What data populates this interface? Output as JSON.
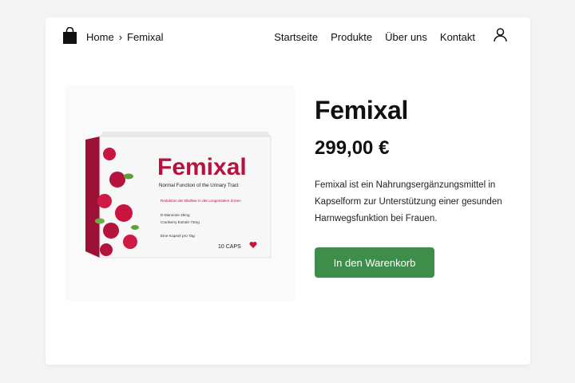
{
  "breadcrumb": {
    "home": "Home",
    "separator": "›",
    "current": "Femixal"
  },
  "nav": {
    "items": [
      "Startseite",
      "Produkte",
      "Über uns",
      "Kontakt"
    ]
  },
  "product": {
    "title": "Femixal",
    "price": "299,00 €",
    "description": "Femixal ist ein Nahrungsergänzungsmittel in Kapselform zur Unterstützung einer gesunden Harnwegsfunktion bei Frauen.",
    "cart_label": "In den Warenkorb",
    "package": {
      "brand": "Femixal",
      "subtitle": "Normal Function of the Urinary Tract",
      "bullet1": "Reduktion der Blutlinie in den urogenitalen Zonen",
      "bullet2": "D-Mannose 35mg",
      "bullet3": "Cranberry Extrakt 73mg",
      "dosage": "Eine Kapsel pro Tag",
      "count": "10 CAPS"
    }
  },
  "colors": {
    "button": "#3e8d4a",
    "brand": "#b5123e"
  },
  "icons": {
    "cart": "shopping-bag-icon",
    "account": "user-icon"
  }
}
